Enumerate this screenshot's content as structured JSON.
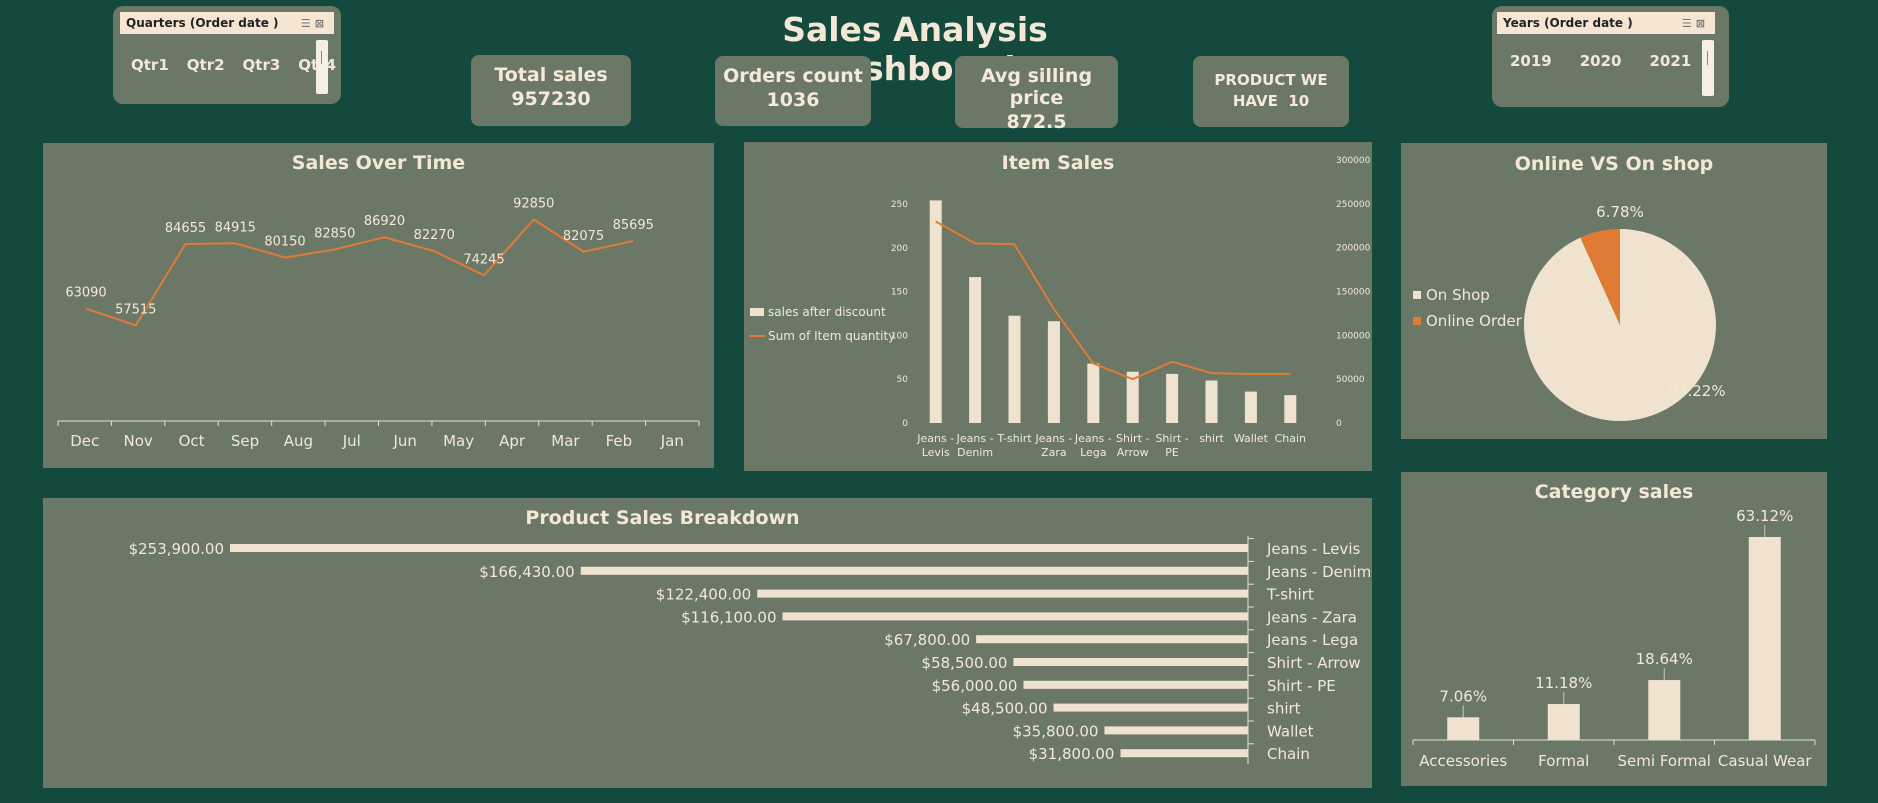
{
  "title": "Sales Analysis Dashboard",
  "slicers": {
    "quarters": {
      "label": "Quarters (Order date )",
      "items": [
        "Qtr1",
        "Qtr2",
        "Qtr3",
        "Qtr4"
      ]
    },
    "years": {
      "label": "Years (Order date )",
      "items": [
        "2019",
        "2020",
        "2021"
      ]
    }
  },
  "kpis": {
    "total_sales": {
      "label": "Total sales",
      "value": "957230"
    },
    "orders_count": {
      "label": "Orders count",
      "value": "1036"
    },
    "avg_price": {
      "label": "Avg silling price",
      "value": "872.5"
    },
    "product": {
      "line1": "PRODUCT WE",
      "line2": "HAVE  10"
    }
  },
  "colors": {
    "background": "#144a3d",
    "panel": "#6b7867",
    "cream": "#efe3cf",
    "orange": "#e07b35"
  },
  "chart_data": [
    {
      "id": "sales_over_time",
      "type": "line",
      "title": "Sales Over Time",
      "categories": [
        "Dec",
        "Nov",
        "Oct",
        "Sep",
        "Aug",
        "Jul",
        "Jun",
        "May",
        "Apr",
        "Mar",
        "Feb",
        "Jan"
      ],
      "values": [
        63090,
        57515,
        84655,
        84915,
        80150,
        82850,
        86920,
        82270,
        74245,
        92850,
        82075,
        85695
      ],
      "data_labels": [
        "63090",
        "57515",
        "84655",
        "84915",
        "80150",
        "82850",
        "86920",
        "82270",
        "74245",
        "92850",
        "82075",
        "85695"
      ],
      "grid": false
    },
    {
      "id": "item_sales",
      "type": "bar",
      "title": "Item Sales",
      "categories": [
        "Jeans - Levis",
        "Jeans - Denim",
        "T-shirt",
        "Jeans - Zara",
        "Jeans - Lega",
        "Shirt - Arrow",
        "Shirt - PE",
        "shirt",
        "Wallet",
        "Chain"
      ],
      "category_lines": [
        [
          "Jeans -",
          "Levis"
        ],
        [
          "Jeans -",
          "Denim"
        ],
        [
          "T-shirt"
        ],
        [
          "Jeans -",
          "Zara"
        ],
        [
          "Jeans -",
          "Lega"
        ],
        [
          "Shirt -",
          "Arrow"
        ],
        [
          "Shirt -",
          "PE"
        ],
        [
          "shirt"
        ],
        [
          "Wallet"
        ],
        [
          "Chain"
        ]
      ],
      "series": [
        {
          "name": "sales after discount",
          "type": "bar",
          "axis": "right",
          "values": [
            253900,
            166430,
            122400,
            116100,
            67800,
            58500,
            56000,
            48500,
            35800,
            31800
          ]
        },
        {
          "name": "Sum of Item quantity",
          "type": "line",
          "axis": "left",
          "values": [
            230,
            205,
            204,
            130,
            68,
            50,
            70,
            57,
            56,
            56
          ]
        }
      ],
      "y_left": {
        "ticks": [
          "0",
          "50",
          "100",
          "150",
          "200",
          "250"
        ],
        "range": [
          0,
          250
        ]
      },
      "y_right": {
        "ticks": [
          "0",
          "50000",
          "100000",
          "150000",
          "200000",
          "250000",
          "300000"
        ],
        "range": [
          0,
          300000
        ]
      },
      "legend_position": "left"
    },
    {
      "id": "online_vs_shop",
      "type": "pie",
      "title": "Online VS On shop",
      "labels": [
        "On Shop",
        "Online Order"
      ],
      "values": [
        93.22,
        6.78
      ],
      "data_labels": [
        "93.22%",
        "6.78%"
      ],
      "legend_position": "left"
    },
    {
      "id": "product_breakdown",
      "type": "bar",
      "orientation": "horizontal",
      "title": "Product Sales Breakdown",
      "categories": [
        "Jeans - Levis",
        "Jeans - Denim",
        "T-shirt",
        "Jeans - Zara",
        "Jeans - Lega",
        "Shirt - Arrow",
        "Shirt - PE",
        "shirt",
        "Wallet",
        "Chain"
      ],
      "values": [
        253900,
        166430,
        122400,
        116100,
        67800,
        58500,
        56000,
        48500,
        35800,
        31800
      ],
      "data_labels": [
        "$253,900.00",
        "$166,430.00",
        "$122,400.00",
        "$116,100.00",
        "$67,800.00",
        "$58,500.00",
        "$56,000.00",
        "$48,500.00",
        "$35,800.00",
        "$31,800.00"
      ]
    },
    {
      "id": "category_sales",
      "type": "bar",
      "title": "Category sales",
      "categories": [
        "Accessories",
        "Formal",
        "Semi Formal",
        "Casual Wear"
      ],
      "values": [
        7.06,
        11.18,
        18.64,
        63.12
      ],
      "data_labels": [
        "7.06%",
        "11.18%",
        "18.64%",
        "63.12%"
      ]
    }
  ]
}
